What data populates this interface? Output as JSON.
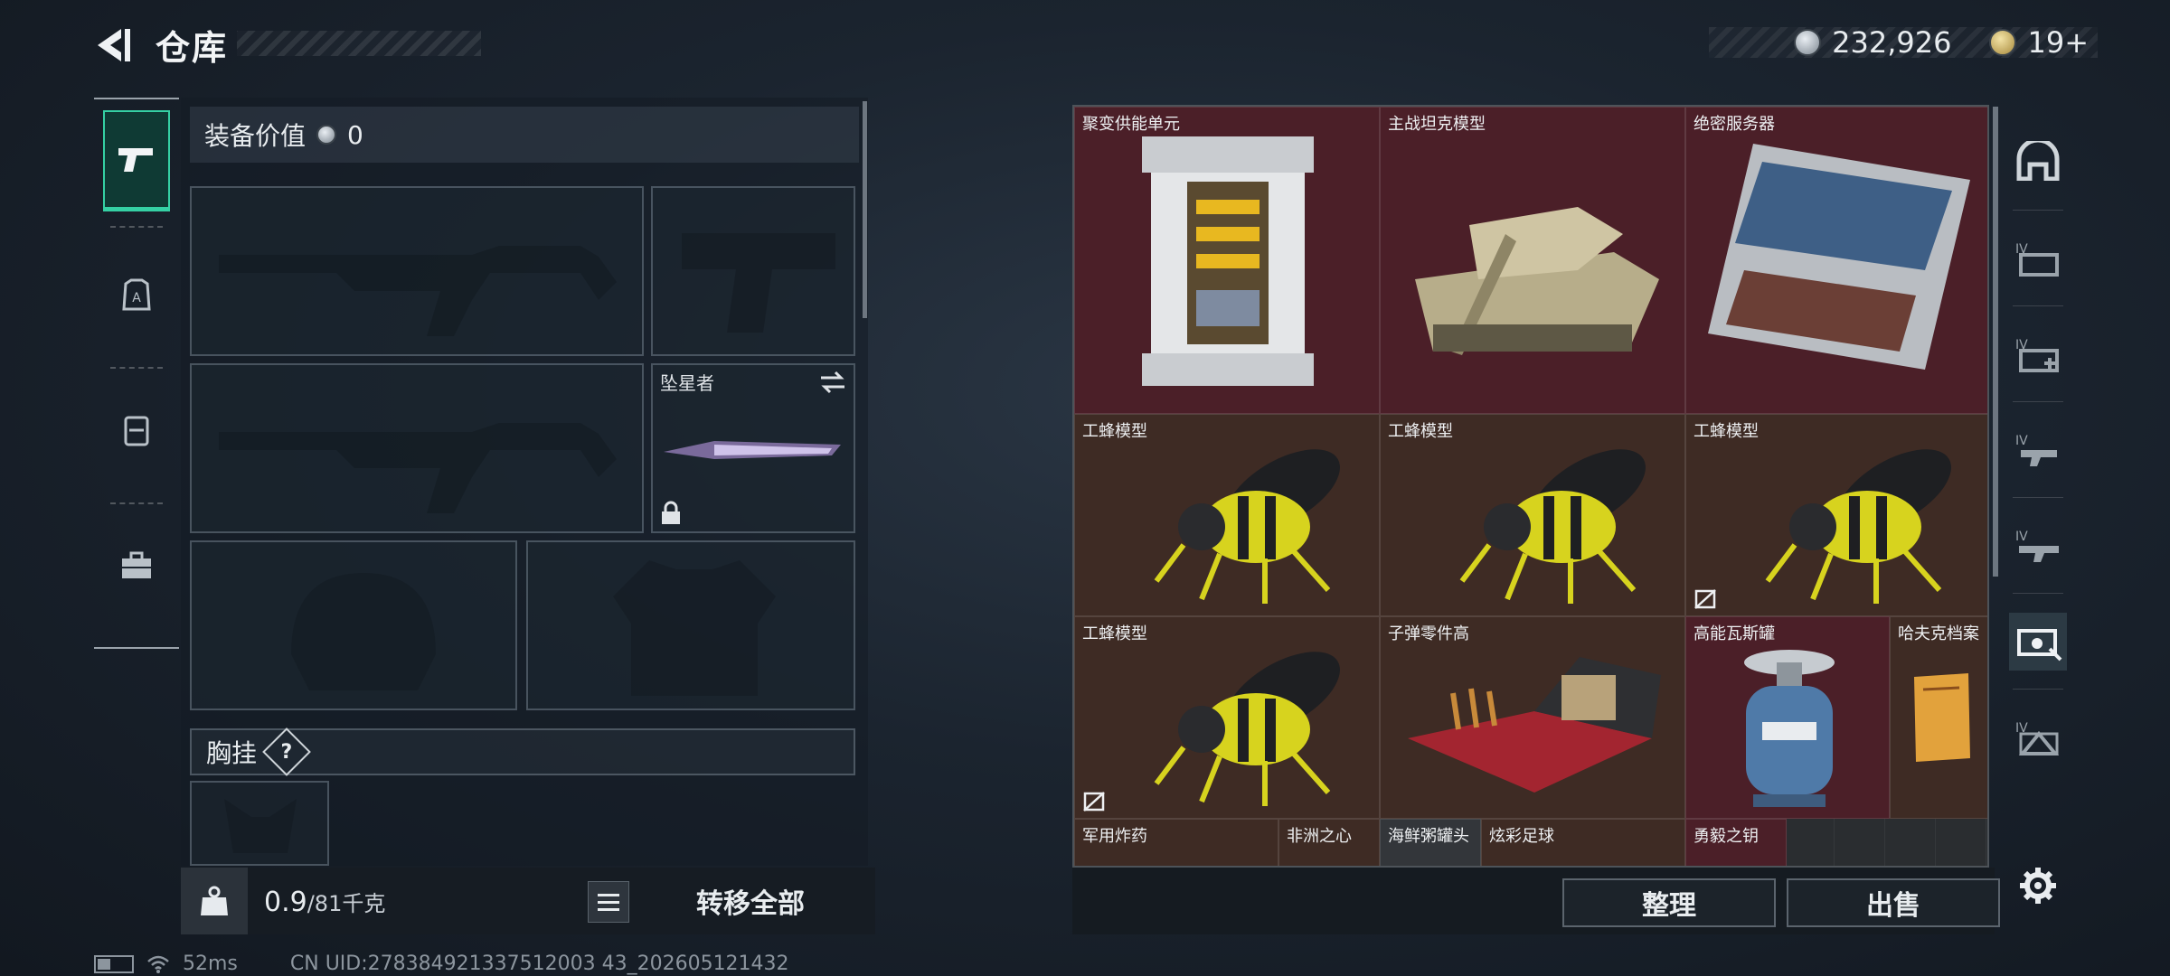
{
  "header": {
    "title": "仓库"
  },
  "currency": {
    "coins": "232,926",
    "tickets": "19+"
  },
  "equipment": {
    "value_label": "装备价值",
    "value": "0",
    "melee_slot_label": "坠星者",
    "chest_rig_label": "胸挂",
    "chest_rig_help": "?"
  },
  "carry": {
    "weight_current": "0.9",
    "weight_max": "/81千克",
    "transfer_all": "转移全部"
  },
  "stash": {
    "items": [
      {
        "label": "聚变供能单元",
        "rarity": "red",
        "icon": "fusion-power-unit-icon"
      },
      {
        "label": "主战坦克模型",
        "rarity": "red",
        "icon": "tank-model-icon"
      },
      {
        "label": "绝密服务器",
        "rarity": "red",
        "icon": "server-icon"
      },
      {
        "label": "工蜂模型",
        "rarity": "brown",
        "icon": "worker-bee-model-icon"
      },
      {
        "label": "工蜂模型",
        "rarity": "brown",
        "icon": "worker-bee-model-icon"
      },
      {
        "label": "工蜂模型",
        "rarity": "brown",
        "icon": "worker-bee-model-icon"
      },
      {
        "label": "工蜂模型",
        "rarity": "brown",
        "icon": "worker-bee-model-icon"
      },
      {
        "label": "子弹零件高",
        "rarity": "brown",
        "icon": "ammo-parts-icon"
      },
      {
        "label": "高能瓦斯罐",
        "rarity": "red",
        "icon": "gas-canister-icon"
      },
      {
        "label": "哈夫克档案",
        "rarity": "brown",
        "icon": "documents-icon"
      },
      {
        "label": "军用炸药",
        "rarity": "brown",
        "icon": "explosive-icon"
      },
      {
        "label": "非洲之心",
        "rarity": "brown",
        "icon": "gem-icon"
      },
      {
        "label": "海鲜粥罐头",
        "rarity": "gray",
        "icon": "can-icon"
      },
      {
        "label": "炫彩足球",
        "rarity": "brown",
        "icon": "soccer-ball-icon"
      },
      {
        "label": "勇毅之钥",
        "rarity": "red",
        "icon": "key-icon"
      }
    ],
    "sort_label": "整理",
    "sell_label": "出售"
  },
  "status": {
    "ping": "52ms",
    "uid": "CN UID:278384921337512003 43_202605121432"
  },
  "colors": {
    "accent": "#35d0a4",
    "red_rarity": "#4b1f28",
    "brown_rarity": "#3e2b24"
  }
}
